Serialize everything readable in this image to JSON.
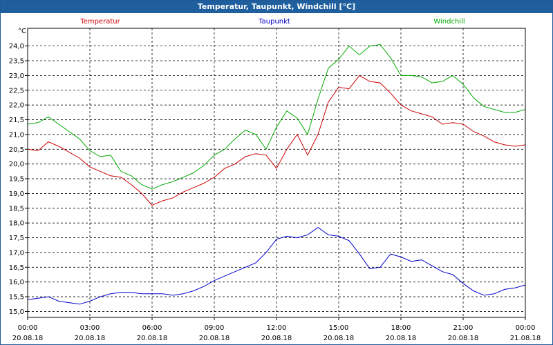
{
  "window": {
    "title": "Temperatur, Taupunkt, Windchill [°C]"
  },
  "colors": {
    "titlebar": "#1f5f9e",
    "grid": "#000000"
  },
  "chart_data": {
    "type": "line",
    "title": "Temperatur, Taupunkt, Windchill [°C]",
    "ylabel": "°C",
    "xlabel": "",
    "ylim": [
      14.8,
      24.6
    ],
    "xlim": [
      0,
      24
    ],
    "grid": true,
    "y_ticks": [
      "15,0",
      "15,5",
      "16,0",
      "16,5",
      "17,0",
      "17,5",
      "18,0",
      "18,5",
      "19,0",
      "19,5",
      "20,0",
      "20,5",
      "21,0",
      "21,5",
      "22,0",
      "22,5",
      "23,0",
      "23,5",
      "24,0"
    ],
    "y_tick_values": [
      15.0,
      15.5,
      16.0,
      16.5,
      17.0,
      17.5,
      18.0,
      18.5,
      19.0,
      19.5,
      20.0,
      20.5,
      21.0,
      21.5,
      22.0,
      22.5,
      23.0,
      23.5,
      24.0
    ],
    "x_ticks": [
      {
        "time": "00:00",
        "date": "20.08.18"
      },
      {
        "time": "03:00",
        "date": "20.08.18"
      },
      {
        "time": "06:00",
        "date": "20.08.18"
      },
      {
        "time": "09:00",
        "date": "20.08.18"
      },
      {
        "time": "12:00",
        "date": "20.08.18"
      },
      {
        "time": "15:00",
        "date": "20.08.18"
      },
      {
        "time": "18:00",
        "date": "20.08.18"
      },
      {
        "time": "21:00",
        "date": "20.08.18"
      },
      {
        "time": "00:00",
        "date": "21.08.18"
      }
    ],
    "x_tick_hours": [
      0,
      3,
      6,
      9,
      12,
      15,
      18,
      21,
      24
    ],
    "series": [
      {
        "name": "Temperatur",
        "color": "#cc0000",
        "x": [
          0,
          0.5,
          1.0,
          1.5,
          2.0,
          2.5,
          3.0,
          3.5,
          4.0,
          4.5,
          5.0,
          5.5,
          6.0,
          6.5,
          7.0,
          7.5,
          8.0,
          8.5,
          9.0,
          9.5,
          10.0,
          10.5,
          11.0,
          11.5,
          12.0,
          12.5,
          13.0,
          13.5,
          14.0,
          14.5,
          15.0,
          15.5,
          16.0,
          16.5,
          17.0,
          17.5,
          18.0,
          18.5,
          19.0,
          19.5,
          20.0,
          20.5,
          21.0,
          21.5,
          22.0,
          22.5,
          23.0,
          23.5,
          24.0
        ],
        "values": [
          20.5,
          20.45,
          20.75,
          20.6,
          20.4,
          20.2,
          19.9,
          19.75,
          19.6,
          19.55,
          19.3,
          19.0,
          18.6,
          18.75,
          18.85,
          19.05,
          19.2,
          19.35,
          19.55,
          19.85,
          20.0,
          20.25,
          20.35,
          20.3,
          19.85,
          20.5,
          21.0,
          20.3,
          21.0,
          22.1,
          22.6,
          22.55,
          23.0,
          22.8,
          22.75,
          22.4,
          22.0,
          21.8,
          21.7,
          21.6,
          21.35,
          21.4,
          21.35,
          21.1,
          20.95,
          20.75,
          20.65,
          20.6,
          20.65
        ]
      },
      {
        "name": "Taupunkt",
        "color": "#0000cc",
        "x": [
          0,
          0.5,
          1.0,
          1.5,
          2.0,
          2.5,
          3.0,
          3.5,
          4.0,
          4.5,
          5.0,
          5.5,
          6.0,
          6.5,
          7.0,
          7.5,
          8.0,
          8.5,
          9.0,
          9.5,
          10.0,
          10.5,
          11.0,
          11.5,
          12.0,
          12.5,
          13.0,
          13.5,
          14.0,
          14.5,
          15.0,
          15.5,
          16.0,
          16.5,
          17.0,
          17.5,
          18.0,
          18.5,
          19.0,
          19.5,
          20.0,
          20.5,
          21.0,
          21.5,
          22.0,
          22.5,
          23.0,
          23.5,
          24.0
        ],
        "values": [
          15.4,
          15.45,
          15.5,
          15.35,
          15.3,
          15.25,
          15.35,
          15.5,
          15.6,
          15.65,
          15.65,
          15.6,
          15.6,
          15.6,
          15.55,
          15.6,
          15.7,
          15.85,
          16.05,
          16.2,
          16.35,
          16.5,
          16.65,
          17.0,
          17.45,
          17.55,
          17.5,
          17.6,
          17.85,
          17.6,
          17.55,
          17.4,
          16.95,
          16.45,
          16.5,
          16.95,
          16.85,
          16.7,
          16.75,
          16.55,
          16.35,
          16.25,
          15.95,
          15.7,
          15.55,
          15.6,
          15.75,
          15.8,
          15.9
        ]
      },
      {
        "name": "Windchill",
        "color": "#00aa00",
        "x": [
          0,
          0.5,
          1.0,
          1.5,
          2.0,
          2.5,
          3.0,
          3.5,
          4.0,
          4.5,
          5.0,
          5.5,
          6.0,
          6.5,
          7.0,
          7.5,
          8.0,
          8.5,
          9.0,
          9.5,
          10.0,
          10.5,
          11.0,
          11.5,
          12.0,
          12.5,
          13.0,
          13.5,
          14.0,
          14.5,
          15.0,
          15.5,
          16.0,
          16.5,
          17.0,
          17.5,
          18.0,
          18.5,
          19.0,
          19.5,
          20.0,
          20.5,
          21.0,
          21.5,
          22.0,
          22.5,
          23.0,
          23.5,
          24.0
        ],
        "values": [
          21.35,
          21.4,
          21.6,
          21.35,
          21.1,
          20.85,
          20.45,
          20.25,
          20.3,
          19.75,
          19.6,
          19.3,
          19.15,
          19.3,
          19.4,
          19.55,
          19.7,
          19.95,
          20.3,
          20.5,
          20.85,
          21.15,
          21.0,
          20.5,
          21.25,
          21.8,
          21.55,
          21.0,
          22.2,
          23.25,
          23.55,
          24.0,
          23.7,
          24.0,
          24.05,
          23.6,
          23.0,
          23.0,
          22.95,
          22.75,
          22.8,
          23.0,
          22.7,
          22.25,
          21.95,
          21.85,
          21.75,
          21.75,
          21.85
        ]
      }
    ]
  }
}
